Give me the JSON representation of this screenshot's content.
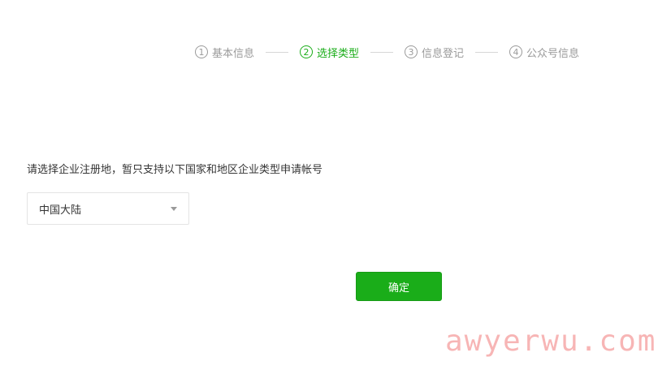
{
  "steps": [
    {
      "number": "1",
      "label": "基本信息",
      "state": "done"
    },
    {
      "number": "2",
      "label": "选择类型",
      "state": "active"
    },
    {
      "number": "3",
      "label": "信息登记",
      "state": "pending"
    },
    {
      "number": "4",
      "label": "公众号信息",
      "state": "pending"
    }
  ],
  "instruction": "请选择企业注册地，暂只支持以下国家和地区企业类型申请帐号",
  "region_select": {
    "value": "中国大陆"
  },
  "confirm_button": {
    "label": "确定"
  },
  "watermark": {
    "text": "awyerwu.com"
  },
  "colors": {
    "accent": "#1aad19",
    "inactive": "#9a9a9a",
    "text": "#353535",
    "watermark": "#f07878"
  }
}
